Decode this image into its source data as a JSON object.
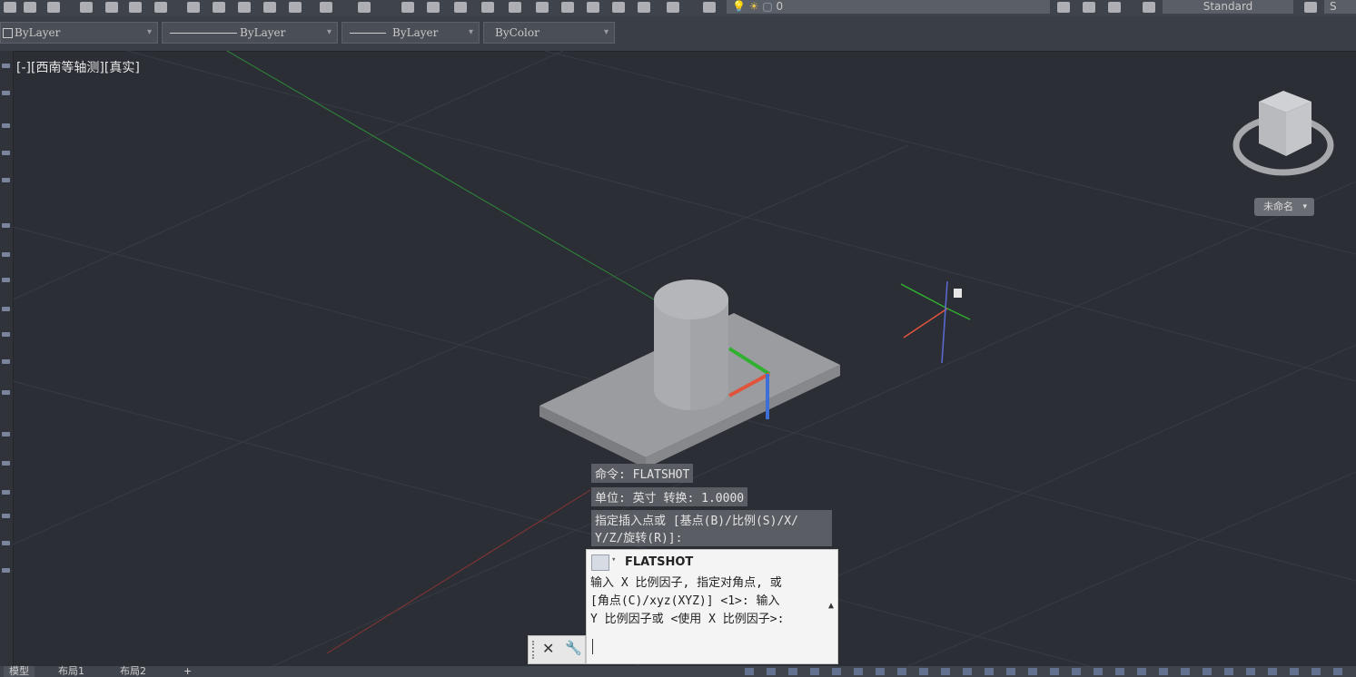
{
  "toolbar": {
    "layer_name": "0",
    "style_name": "Standard",
    "style_name_2": "S"
  },
  "properties": {
    "layer": "ByLayer",
    "linetype": "ByLayer",
    "lineweight": "ByLayer",
    "plot_style": "ByColor"
  },
  "viewport": {
    "label": "[-][西南等轴测][真实]"
  },
  "viewcube": {
    "named_view": "未命名"
  },
  "command_history": [
    "命令: FLATSHOT",
    "单位: 英寸   转换:    1.0000",
    "指定插入点或 [基点(B)/比例(S)/X/",
    "Y/Z/旋转(R)]:"
  ],
  "command_panel": {
    "title": "FLATSHOT",
    "line1": "输入 X 比例因子, 指定对角点, 或",
    "line2": "[角点(C)/xyz(XYZ)] <1>:  输入",
    "line3": "Y 比例因子或 <使用 X 比例因子>:"
  },
  "layout_tabs": [
    "模型",
    "布局1",
    "布局2"
  ],
  "colors": {
    "background": "#2b2e35",
    "solid": "#9a9ca0",
    "axis_x": "#e0543c",
    "axis_y": "#2fb12f",
    "axis_z": "#3d6fd6"
  }
}
